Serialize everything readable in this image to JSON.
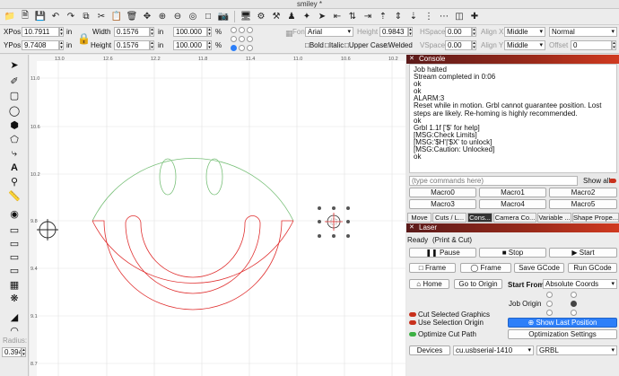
{
  "window": {
    "title": "smiley *"
  },
  "props": {
    "xpos_label": "XPos",
    "xpos_value": "10.7911",
    "xpos_unit": "in",
    "ypos_label": "YPos",
    "ypos_value": "9.7408",
    "ypos_unit": "in",
    "width_label": "Width",
    "width_value": "0.1576",
    "width_unit": "in",
    "height_label": "Height",
    "height_value": "0.1576",
    "height_unit": "in",
    "scale_w": "100.000",
    "scale_h": "100.000",
    "percent": "%",
    "font_label": "Font",
    "font_value": "Arial",
    "fheight_label": "Height",
    "fheight_value": "0.9843",
    "hspace_label": "HSpace",
    "hspace_value": "0.00",
    "vspace_label": "VSpace",
    "vspace_value": "0.00",
    "alignx_label": "Align X",
    "alignx_value": "Middle",
    "aligny_label": "Align Y",
    "aligny_value": "Middle",
    "style_value": "Normal",
    "offset_label": "Offset",
    "offset_value": "0",
    "bold_label": "Bold",
    "italic_label": "Italic",
    "upper_label": "Upper Case",
    "welded_label": "Welded"
  },
  "canvas": {
    "x_ticks": [
      "13.0",
      "12.6",
      "12.2",
      "11.8",
      "11.4",
      "11.0",
      "10.6",
      "10.2"
    ],
    "y_ticks": [
      "11.0",
      "10.6",
      "10.2",
      "9.8",
      "9.4",
      "9.1",
      "8.7"
    ],
    "radius_label": "Radius:",
    "radius_value": "0.394"
  },
  "console": {
    "title": "Console",
    "lines": [
      "Job halted",
      "Stream completed in 0:06",
      "ok",
      "ok",
      "ALARM:3",
      "Reset while in motion. Grbl cannot guarantee position. Lost steps are likely. Re-homing is highly recommended.",
      "ok",
      "Grbl 1.1f ['$' for help]",
      "[MSG:Check Limits]",
      "[MSG:'$H'|'$X' to unlock]",
      "[MSG:Caution: Unlocked]",
      "ok"
    ],
    "command_placeholder": "(type commands here)",
    "show_all": "Show all",
    "macros": [
      "Macro0",
      "Macro1",
      "Macro2",
      "Macro3",
      "Macro4",
      "Macro5"
    ]
  },
  "tabs": [
    "Move",
    "Cuts / L...",
    "Cons...",
    "Camera Co...",
    "Variable ...",
    "Shape Prope..."
  ],
  "laser": {
    "title": "Laser",
    "status": "Ready",
    "mode": "(Print & Cut)",
    "pause": "Pause",
    "stop": "Stop",
    "start": "Start",
    "frame1": "Frame",
    "frame2": "Frame",
    "save_gcode": "Save GCode",
    "run_gcode": "Run GCode",
    "home": "Home",
    "go_origin": "Go to Origin",
    "start_from_label": "Start From:",
    "start_from_value": "Absolute Coords",
    "job_origin": "Job Origin",
    "cut_selected": "Cut Selected Graphics",
    "use_selection_origin": "Use Selection Origin",
    "optimize": "Optimize Cut Path",
    "show_last": "Show Last Position",
    "opt_settings": "Optimization Settings",
    "devices": "Devices",
    "port": "cu.usbserial-1410",
    "controller": "GRBL"
  },
  "colors": {
    "accent": "#2d7ff9",
    "cut_red": "#e03030",
    "cut_green": "#79c079",
    "panel_red": "#b8301c"
  }
}
